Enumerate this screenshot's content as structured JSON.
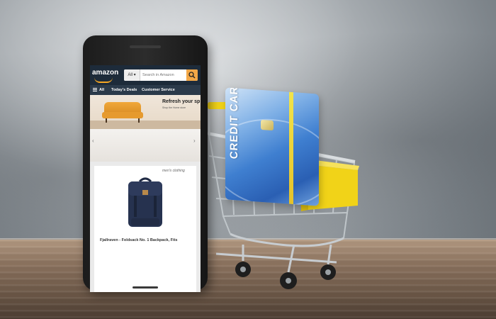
{
  "scene": {
    "card_label": "CREDIT CARD"
  },
  "amazon": {
    "logo": "amazon",
    "search": {
      "category": "All",
      "placeholder": "Search in Amazon"
    },
    "nav": {
      "all": "All",
      "deals": "Today's Deals",
      "service": "Customer Service"
    },
    "banner": {
      "title": "Refresh your sp",
      "subtitle": "Shop the Home store"
    },
    "product": {
      "category": "men's clothing",
      "title": "Fjallraven - Foldsack No. 1 Backpack, Fits"
    }
  },
  "colors": {
    "amazon_header": "#1d2b3a",
    "amazon_nav": "#2b3a4a",
    "search_button": "#f3a847",
    "cart_yellow": "#f1d318"
  }
}
